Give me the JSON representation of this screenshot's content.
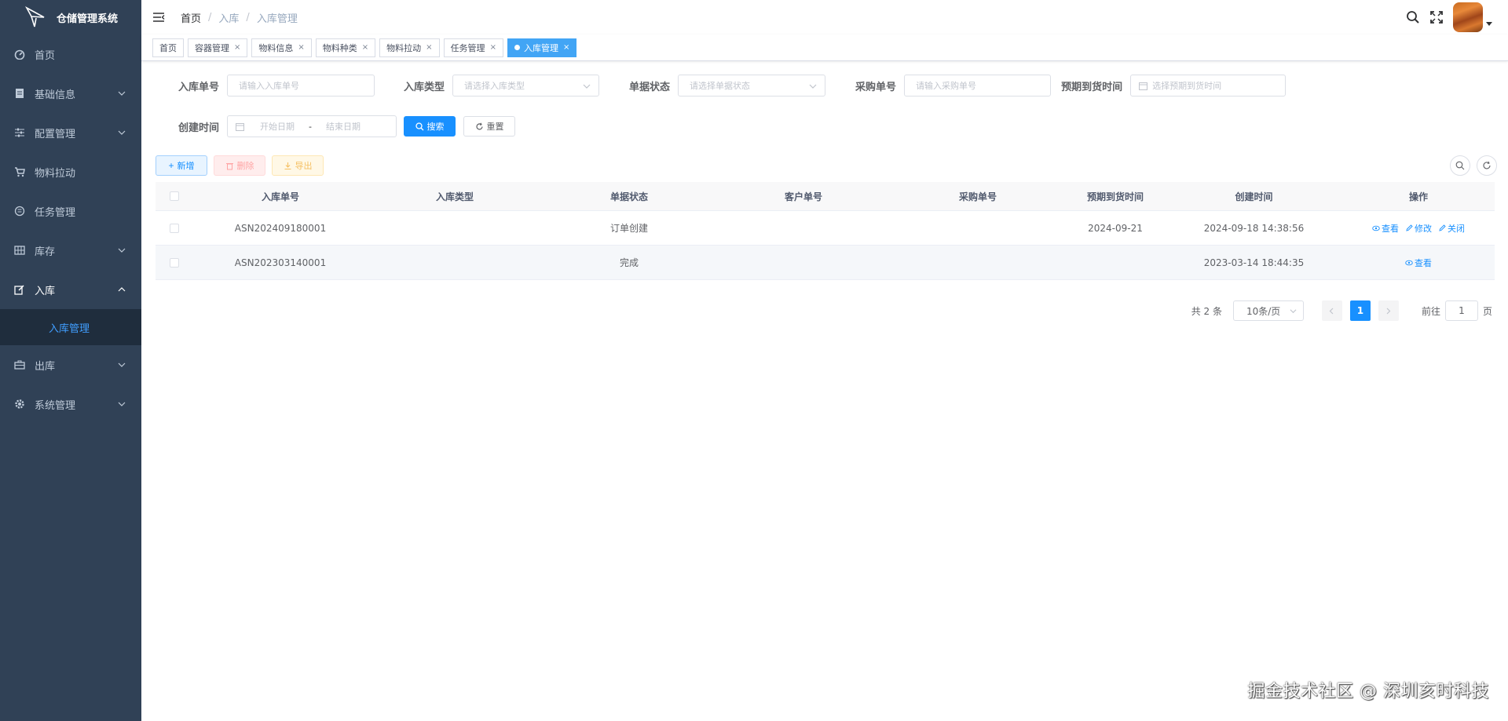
{
  "app": {
    "title": "仓储管理系统"
  },
  "sidebar": {
    "items": [
      {
        "label": "首页",
        "icon": "dashboard-icon",
        "has_children": false
      },
      {
        "label": "基础信息",
        "icon": "document-icon",
        "has_children": true
      },
      {
        "label": "配置管理",
        "icon": "sliders-icon",
        "has_children": true
      },
      {
        "label": "物料拉动",
        "icon": "cart-icon",
        "has_children": false
      },
      {
        "label": "任务管理",
        "icon": "task-icon",
        "has_children": false
      },
      {
        "label": "库存",
        "icon": "grid-icon",
        "has_children": true
      },
      {
        "label": "入库",
        "icon": "edit-icon",
        "has_children": true,
        "expanded": true
      },
      {
        "label": "出库",
        "icon": "briefcase-icon",
        "has_children": true
      },
      {
        "label": "系统管理",
        "icon": "gear-icon",
        "has_children": true
      }
    ],
    "submenu": {
      "label": "入库管理",
      "active": true
    }
  },
  "breadcrumb": [
    "首页",
    "入库",
    "入库管理"
  ],
  "tags": [
    {
      "label": "首页",
      "closable": false
    },
    {
      "label": "容器管理",
      "closable": true
    },
    {
      "label": "物料信息",
      "closable": true
    },
    {
      "label": "物料种类",
      "closable": true
    },
    {
      "label": "物料拉动",
      "closable": true
    },
    {
      "label": "任务管理",
      "closable": true
    },
    {
      "label": "入库管理",
      "closable": true,
      "active": true
    }
  ],
  "search": {
    "asn_no": {
      "label": "入库单号",
      "placeholder": "请输入入库单号"
    },
    "type": {
      "label": "入库类型",
      "placeholder": "请选择入库类型"
    },
    "status": {
      "label": "单据状态",
      "placeholder": "请选择单据状态"
    },
    "po_no": {
      "label": "采购单号",
      "placeholder": "请输入采购单号"
    },
    "eta": {
      "label": "预期到货时间",
      "placeholder": "选择预期到货时间"
    },
    "created": {
      "label": "创建时间",
      "start_placeholder": "开始日期",
      "separator": "-",
      "end_placeholder": "结束日期"
    },
    "search_button": "搜索",
    "reset_button": "重置"
  },
  "toolbar": {
    "add": "新增",
    "delete": "删除",
    "export": "导出"
  },
  "table": {
    "columns": [
      "入库单号",
      "入库类型",
      "单据状态",
      "客户单号",
      "采购单号",
      "预期到货时间",
      "创建时间",
      "操作"
    ],
    "rows": [
      {
        "asn_no": "ASN202409180001",
        "type": "",
        "status": "订单创建",
        "customer_no": "",
        "po_no": "",
        "eta": "2024-09-21",
        "created": "2024-09-18 14:38:56",
        "actions": [
          "查看",
          "修改",
          "关闭"
        ]
      },
      {
        "asn_no": "ASN202303140001",
        "type": "",
        "status": "完成",
        "customer_no": "",
        "po_no": "",
        "eta": "",
        "created": "2023-03-14 18:44:35",
        "actions": [
          "查看"
        ]
      }
    ]
  },
  "pagination": {
    "total": "共 2 条",
    "page_size": "10条/页",
    "current": "1",
    "goto_prefix": "前往",
    "goto_value": "1",
    "goto_suffix": "页"
  },
  "watermark": "掘金技术社区 @ 深圳亥时科技",
  "colors": {
    "sidebar_bg": "#304156",
    "primary": "#1890ff",
    "active_tag": "#42a5f5"
  }
}
